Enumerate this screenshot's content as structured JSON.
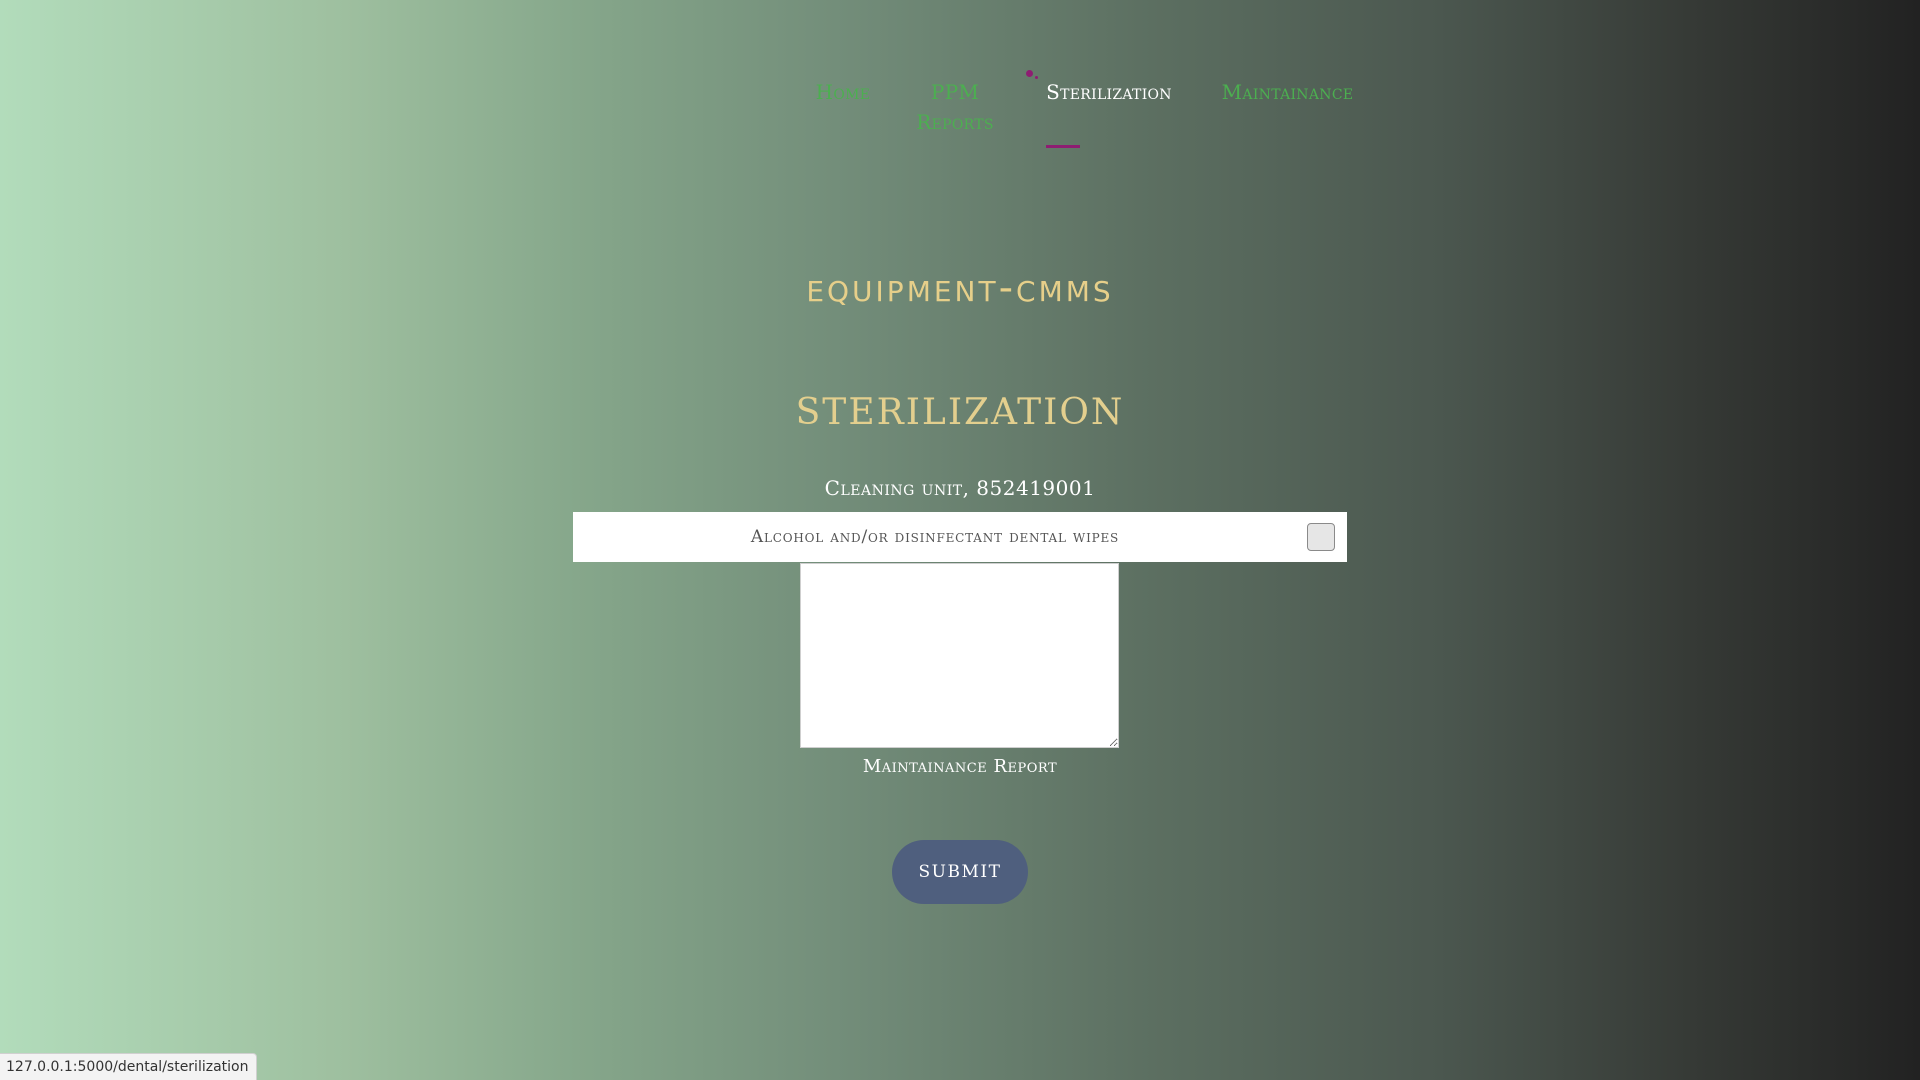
{
  "nav": {
    "home": "Home",
    "ppm_reports": "PPM Reports",
    "sterilization": "Sterilization",
    "maintainance": "Maintainance"
  },
  "brand": "Equipment-CMMS",
  "section_title": "STERILIZATION",
  "unit_label": "Cleaning unit, 852419001",
  "checklist": {
    "item_label": "Alcohol and/or disinfectant dental wipes",
    "checked": false
  },
  "report": {
    "value": "",
    "label": "Maintainance Report"
  },
  "submit_label": "SUBMIT",
  "status_url": "127.0.0.1:5000/dental/sterilization",
  "colors": {
    "nav_link": "#4caf50",
    "nav_active": "#ffffff",
    "nav_indicator": "#8e1d72",
    "title_gold": "#e3cf8e",
    "button": "#4f5f7e"
  }
}
